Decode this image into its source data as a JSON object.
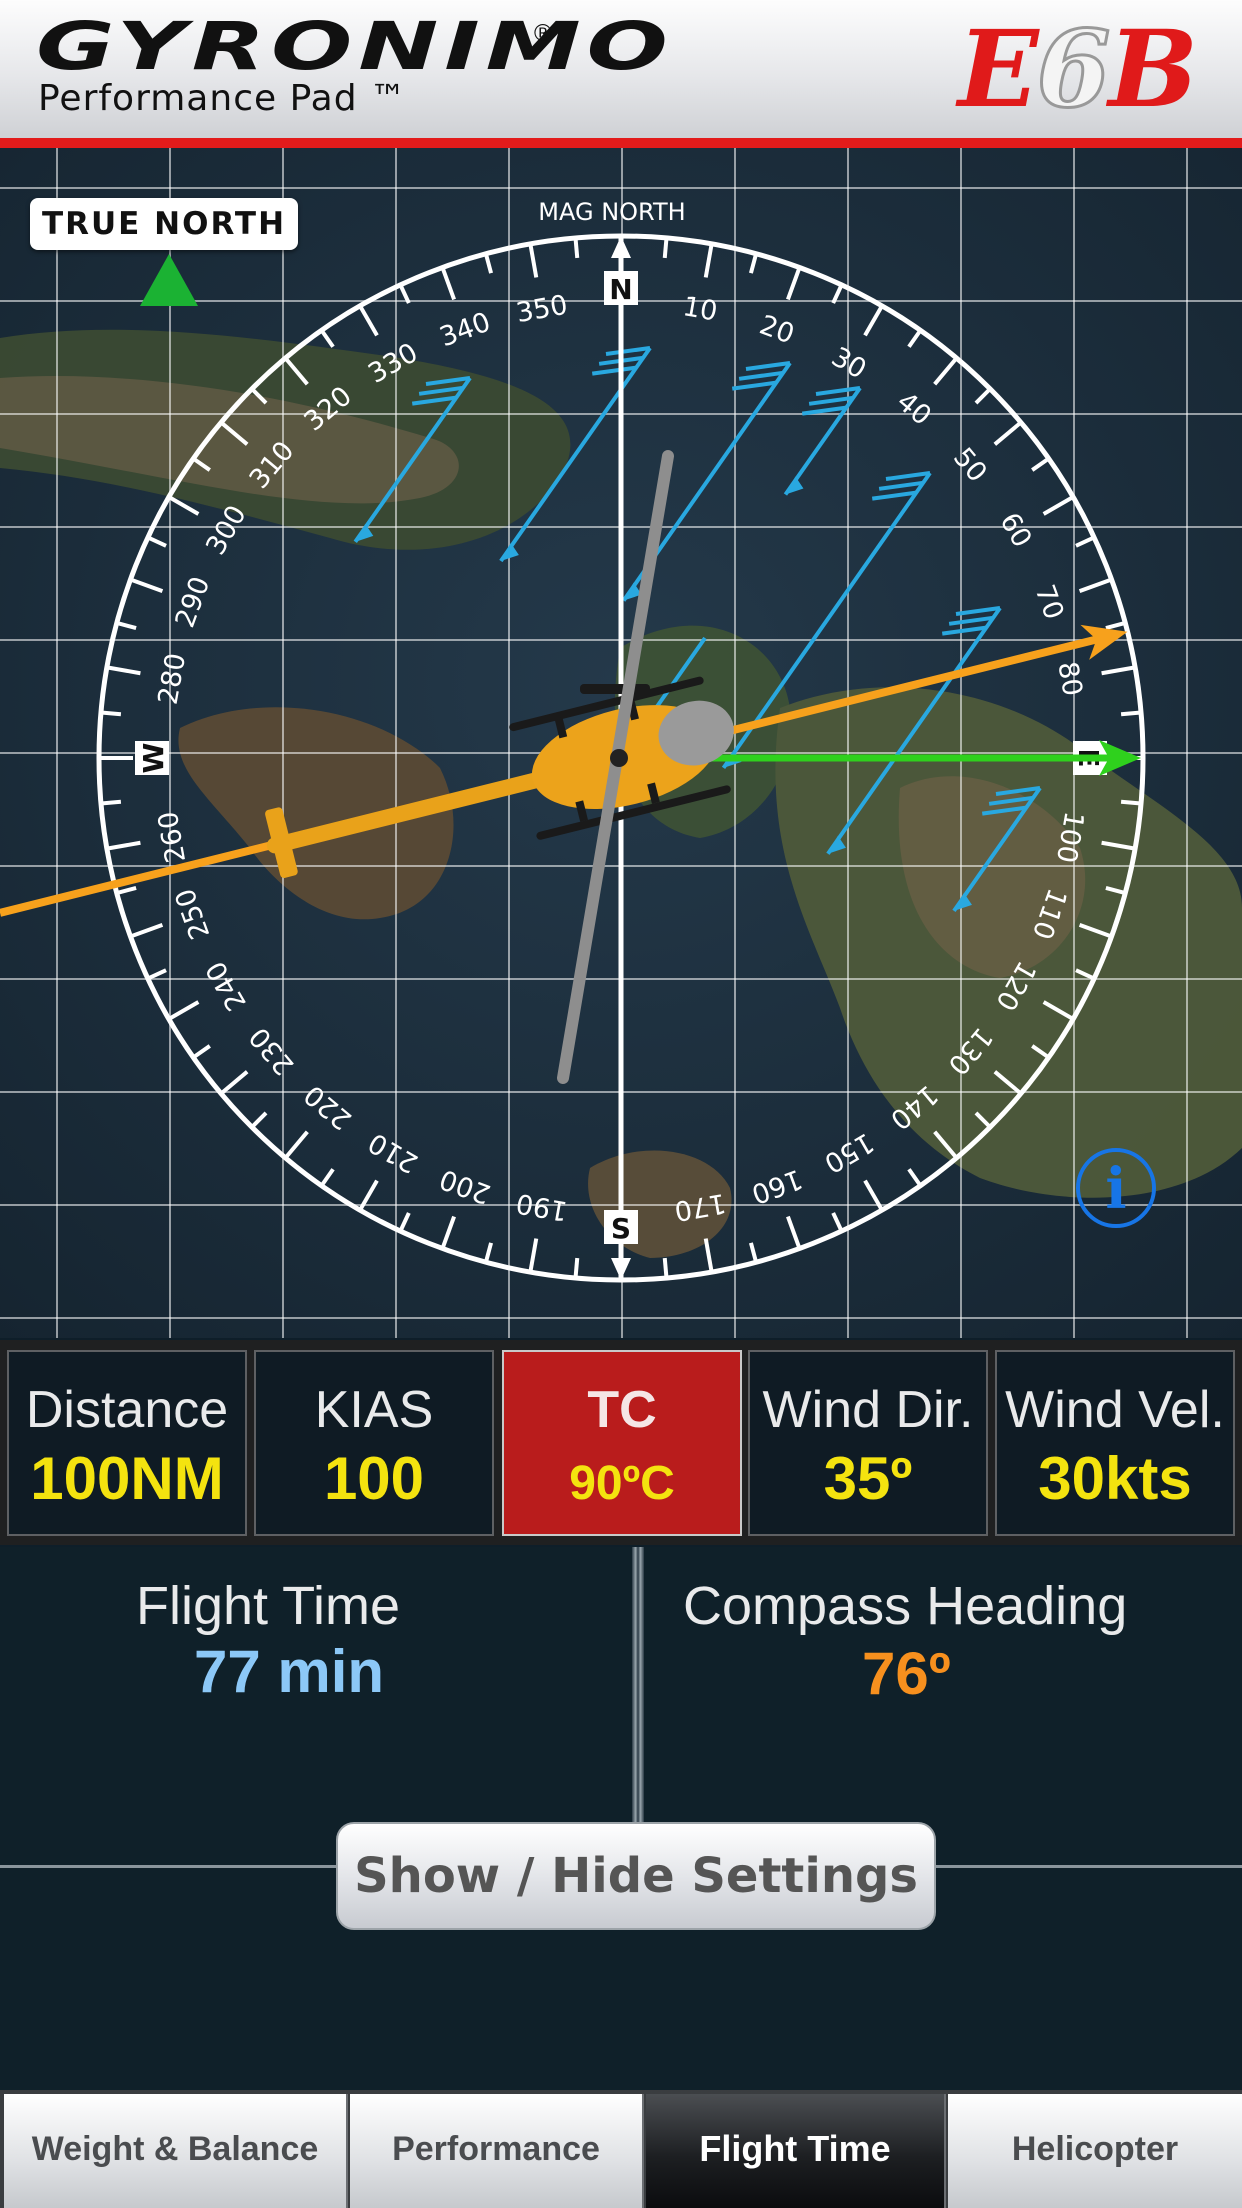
{
  "header": {
    "brand": "GYRONIMO",
    "brand_reg": "®",
    "subtitle": "Performance Pad ™",
    "logo_pre": "E",
    "logo_six": "6",
    "logo_post": "B"
  },
  "compass": {
    "true_north_label": "TRUE NORTH",
    "mag_north_label": "MAG NORTH",
    "cardinals": {
      "n": "N",
      "s": "S",
      "w": "W",
      "e": "E"
    },
    "heading_labels": [
      "10",
      "20",
      "30",
      "40",
      "50",
      "60",
      "70",
      "80",
      "100",
      "110",
      "120",
      "130",
      "140",
      "150",
      "160",
      "170",
      "190",
      "200",
      "210",
      "220",
      "230",
      "240",
      "250",
      "260",
      "280",
      "290",
      "300",
      "310",
      "320",
      "330",
      "340",
      "350"
    ],
    "course_deg": 90,
    "heading_deg": 76,
    "wind_dir_deg": 35,
    "info_label": "i",
    "colors": {
      "course": "#2fd11d",
      "heading": "#f7a11c",
      "wind": "#29a8e0",
      "true_north": "#1bb233"
    }
  },
  "inputs": [
    {
      "label": "Distance",
      "value": "100NM"
    },
    {
      "label": "KIAS",
      "value": "100"
    },
    {
      "label": "TC",
      "value": "90ºC"
    },
    {
      "label": "Wind Dir.",
      "value": "35º"
    },
    {
      "label": "Wind Vel.",
      "value": "30kts"
    }
  ],
  "results": {
    "flight_time_label": "Flight Time",
    "flight_time_value": "77 min",
    "compass_heading_label": "Compass Heading",
    "compass_heading_value": "76º",
    "flight_time_color": "#8cc8f7",
    "heading_color": "#f7901e"
  },
  "settings_button": "Show / Hide Settings",
  "tabs": [
    {
      "label": "Weight & Balance",
      "active": false
    },
    {
      "label": "Performance",
      "active": false
    },
    {
      "label": "Flight Time",
      "active": true
    },
    {
      "label": "Helicopter",
      "active": false
    }
  ]
}
